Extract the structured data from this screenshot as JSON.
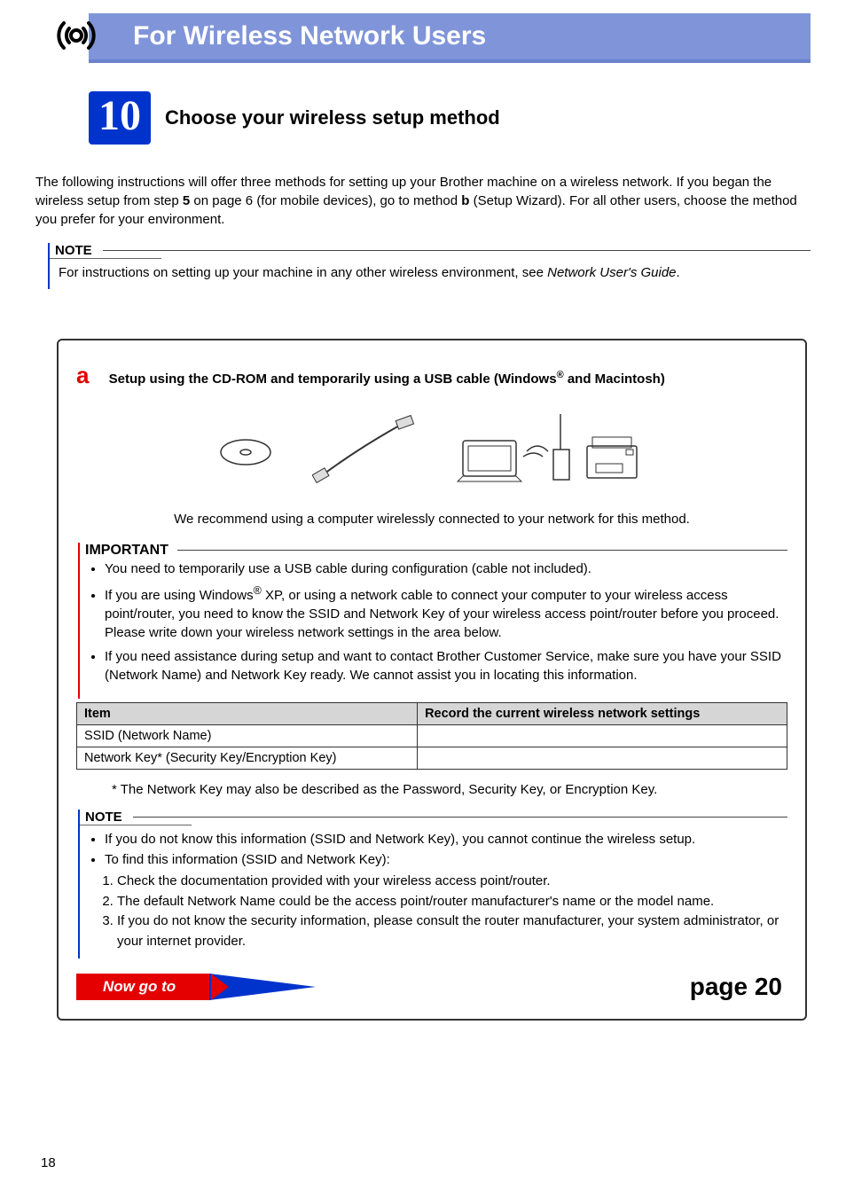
{
  "header": {
    "title": "For Wireless Network Users"
  },
  "step": {
    "number": "10",
    "title": "Choose your wireless setup method"
  },
  "intro_html": "The following instructions will offer three methods for setting up your Brother machine on a wireless network. If you began the wireless setup from step <b>5</b> on page 6 (for mobile devices), go to method <b>b</b> (Setup Wizard). For all other users, choose the method you prefer for your environment.",
  "top_note": {
    "label": "NOTE",
    "body_html": "For instructions on setting up your machine in any other wireless environment, see <i>Network User's Guide</i>."
  },
  "method_a": {
    "letter": "a",
    "title_html": "Setup using the CD-ROM and temporarily using a USB cable (Windows<sup>®</sup> and Macintosh)",
    "recommend": "We recommend using a computer wirelessly connected to your network for this method.",
    "important": {
      "label": "IMPORTANT",
      "bullets_html": [
        "You need to temporarily use a USB cable during configuration (cable not included).",
        "If you are using Windows<sup>®</sup> XP, or using a network cable to connect your computer to your wireless access point/router, you need to know the SSID and Network Key of your wireless access point/router before you proceed. Please write down your wireless network settings in the area below.",
        "If you need assistance during setup and want to contact Brother Customer Service, make sure you have your SSID (Network Name) and Network Key ready. We cannot assist you in locating this information."
      ]
    },
    "table": {
      "head": [
        "Item",
        "Record the current wireless network settings"
      ],
      "rows": [
        [
          "SSID (Network Name)",
          ""
        ],
        [
          "Network Key* (Security Key/Encryption Key)",
          ""
        ]
      ]
    },
    "footnote": "*   The Network Key may also be described as the Password, Security Key, or Encryption Key.",
    "note2": {
      "label": "NOTE",
      "bullets": [
        "If you do not know this information (SSID and Network Key), you cannot continue the wireless setup.",
        "To find this information (SSID and Network Key):"
      ],
      "numbered": [
        "Check the documentation provided with your wireless access point/router.",
        "The default Network Name could be the access point/router manufacturer's name or the model name.",
        "If you do not know the security information, please consult the router manufacturer, your system administrator, or your internet provider."
      ]
    },
    "goto": {
      "label": "Now go to",
      "target": "page 20"
    }
  },
  "page_number": "18"
}
